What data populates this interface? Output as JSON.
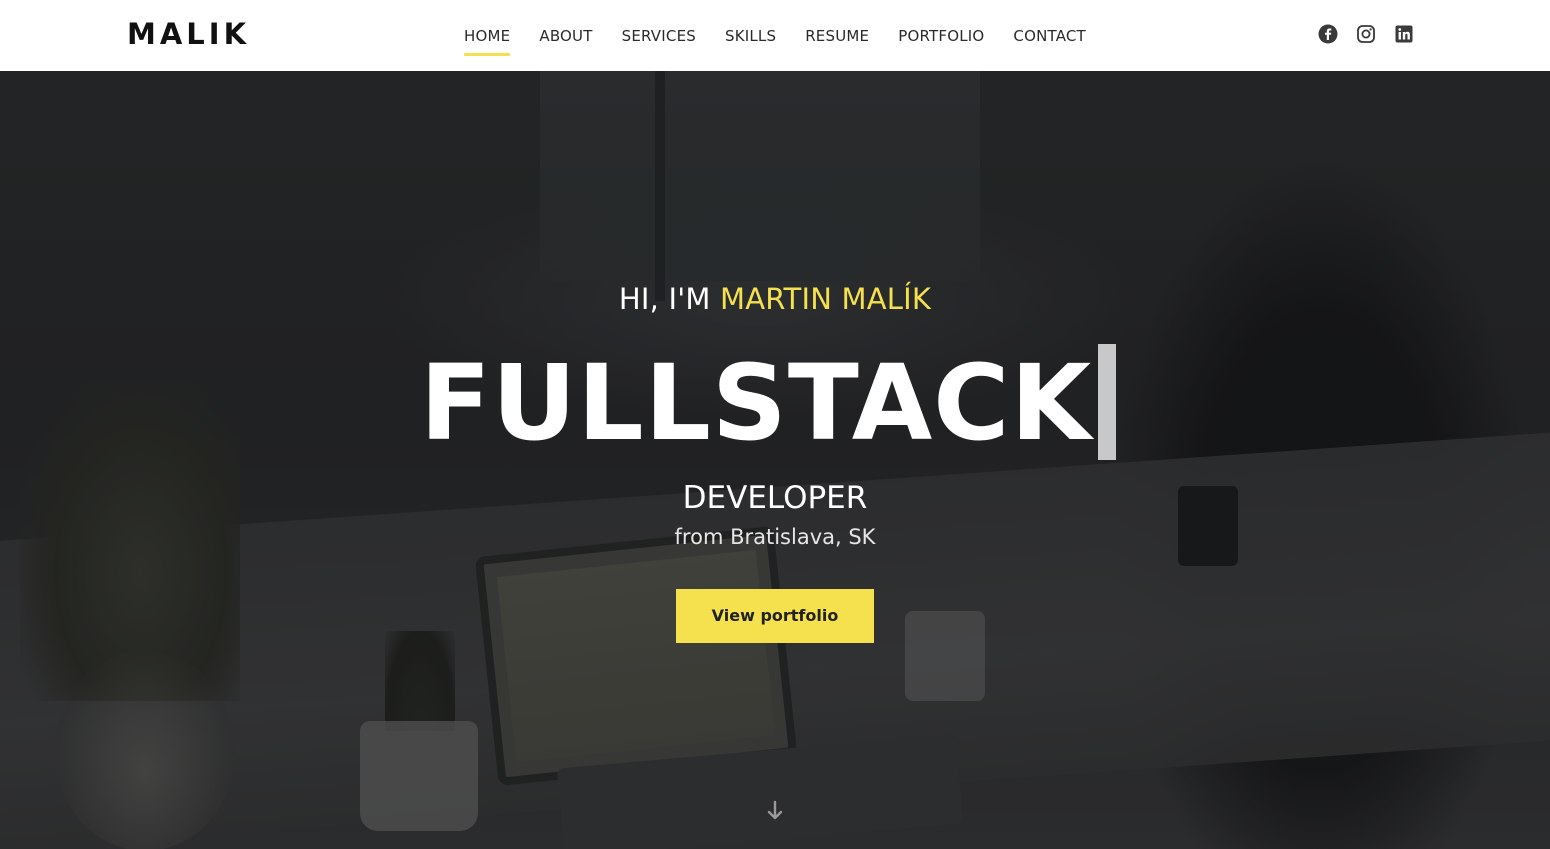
{
  "theme": {
    "accent": "#f5e04e"
  },
  "header": {
    "logo": "MALIK",
    "nav": [
      {
        "label": "HOME",
        "active": true
      },
      {
        "label": "ABOUT",
        "active": false
      },
      {
        "label": "SERVICES",
        "active": false
      },
      {
        "label": "SKILLS",
        "active": false
      },
      {
        "label": "RESUME",
        "active": false
      },
      {
        "label": "PORTFOLIO",
        "active": false
      },
      {
        "label": "CONTACT",
        "active": false
      }
    ],
    "social_icons": [
      "facebook-icon",
      "instagram-icon",
      "linkedin-icon"
    ]
  },
  "hero": {
    "greeting_prefix": "HI, I'M ",
    "name": "MARTIN MALÍK",
    "title": "FULLSTACK",
    "role": "DEVELOPER",
    "location": "from Bratislava, SK",
    "cta_label": "View portfolio",
    "scroll_icon": "arrow-down-icon"
  }
}
